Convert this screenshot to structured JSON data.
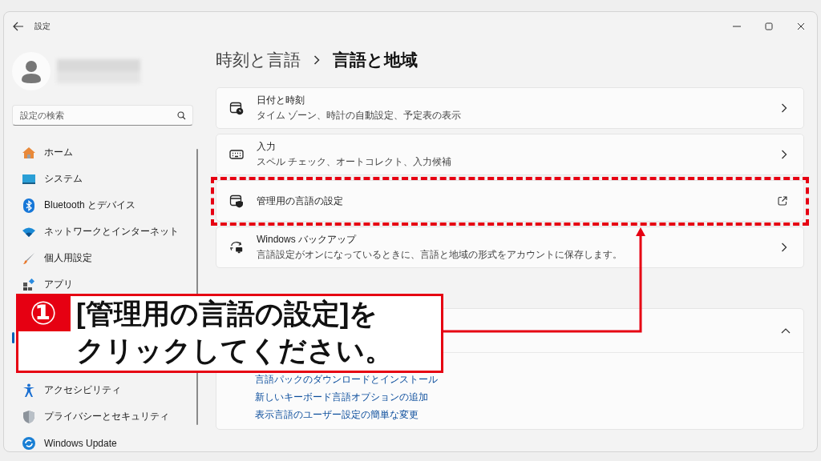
{
  "window": {
    "title": "設定"
  },
  "sidebar": {
    "search": {
      "placeholder": "設定の検索"
    },
    "items": [
      {
        "kind": "home",
        "label": "ホーム",
        "selected": false
      },
      {
        "kind": "system",
        "label": "システム",
        "selected": false
      },
      {
        "kind": "bluetooth",
        "label": "Bluetooth とデバイス",
        "selected": false
      },
      {
        "kind": "network",
        "label": "ネットワークとインターネット",
        "selected": false
      },
      {
        "kind": "brush",
        "label": "個人用設定",
        "selected": false
      },
      {
        "kind": "apps",
        "label": "アプリ",
        "selected": false
      },
      {
        "kind": "covered",
        "selected": true
      },
      {
        "kind": "accessibility",
        "label": "アクセシビリティ",
        "selected": false
      },
      {
        "kind": "shield",
        "label": "プライバシーとセキュリティ",
        "selected": false
      },
      {
        "kind": "update",
        "label": "Windows Update",
        "selected": false
      }
    ]
  },
  "breadcrumb": {
    "parent": "時刻と言語",
    "current": "言語と地域"
  },
  "cards": [
    {
      "kind": "nav",
      "title": "日付と時刻",
      "subtitle": "タイム ゾーン、時計の自動設定、予定表の表示",
      "highlighted": false
    },
    {
      "kind": "nav",
      "title": "入力",
      "subtitle": "スペル チェック、オートコレクト、入力候補",
      "highlighted": false
    },
    {
      "kind": "external",
      "title": "管理用の言語の設定",
      "highlighted": true
    },
    {
      "kind": "nav",
      "title": "Windows バックアップ",
      "subtitle": "言語設定がオンになっているときに、言語と地域の形式をアカウントに保存します。",
      "highlighted": false
    }
  ],
  "help": {
    "expanded": true,
    "links": [
      "言語パックのダウンロードとインストール",
      "新しいキーボード言語オプションの追加",
      "表示言語のユーザー設定の簡単な変更"
    ]
  },
  "callout": {
    "number": "①",
    "lines": [
      "[管理用の言語の設定]を",
      "クリックしてください。"
    ]
  }
}
